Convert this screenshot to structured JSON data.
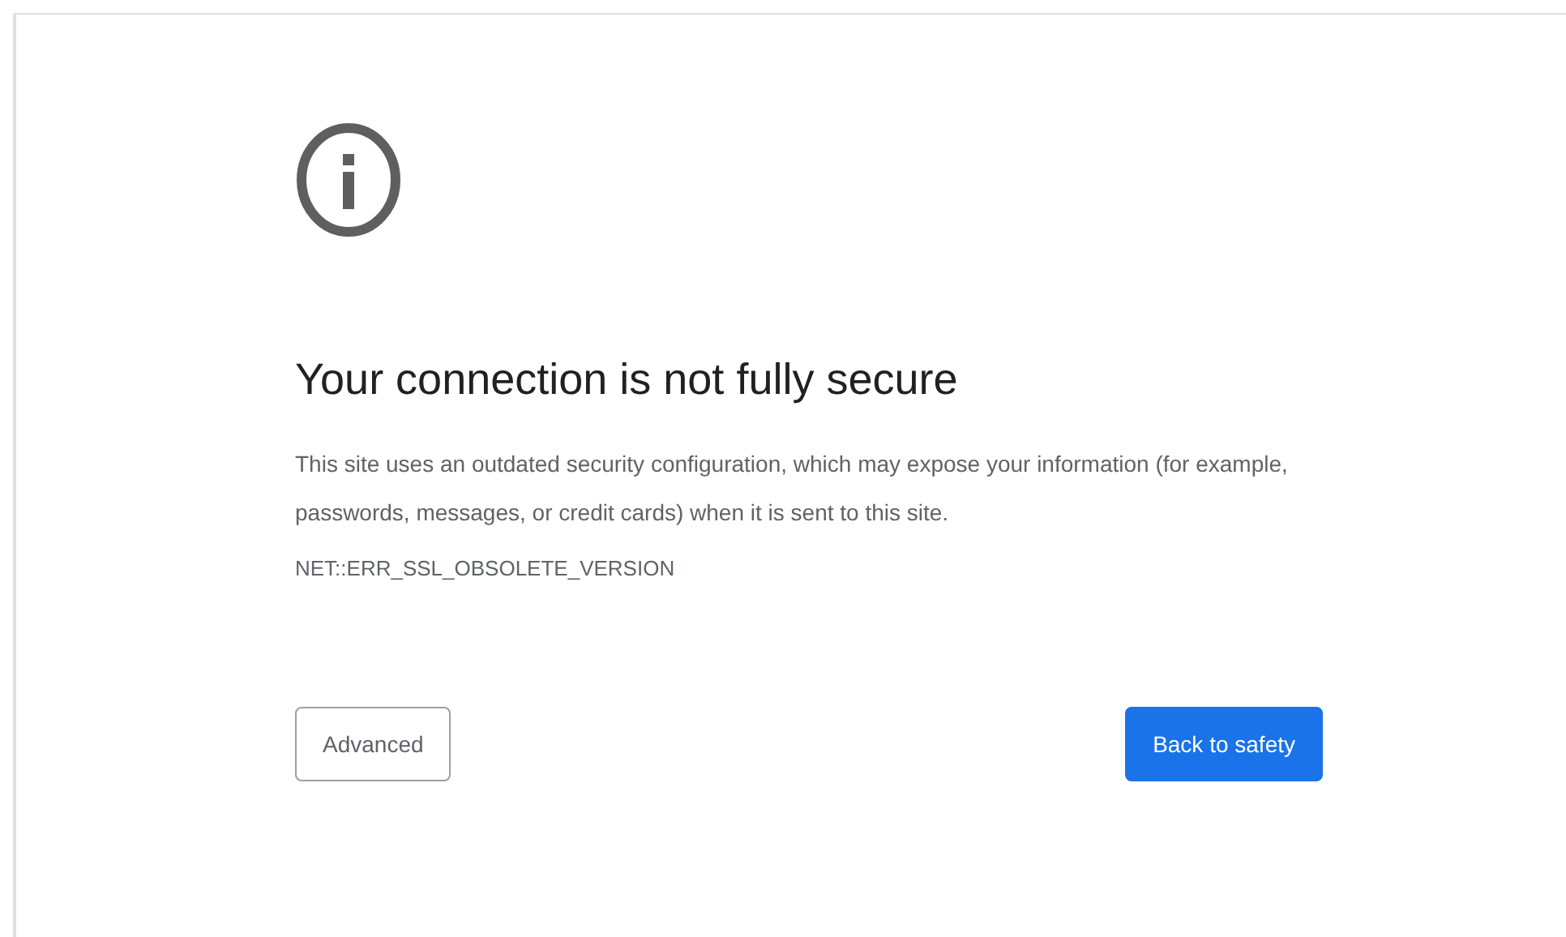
{
  "heading": "Your connection is not fully secure",
  "description": "This site uses an outdated security configuration, which may expose your information (for example, passwords, messages, or credit cards) when it is sent to this site.",
  "error_code": "NET::ERR_SSL_OBSOLETE_VERSION",
  "buttons": [
    {
      "label": "Advanced",
      "kind": "secondary"
    },
    {
      "label": "Back to safety",
      "kind": "primary"
    }
  ]
}
